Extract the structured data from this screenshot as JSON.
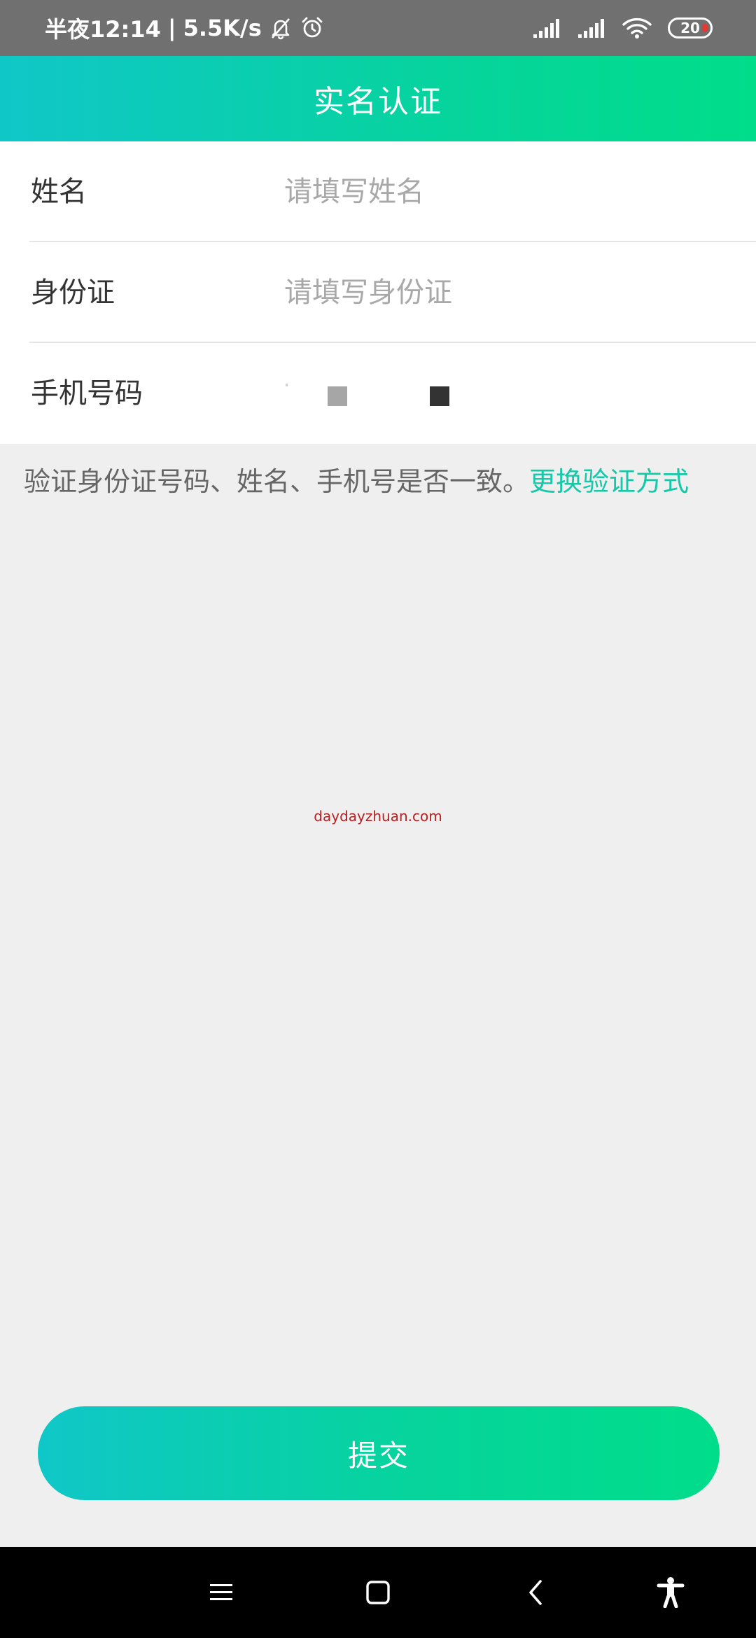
{
  "status_bar": {
    "time": "半夜12:14",
    "separator": "|",
    "speed": "5.5K/s",
    "battery": "20",
    "icons": [
      "mute-bell-icon",
      "alarm-icon",
      "signal-icon",
      "signal-icon",
      "wifi-icon",
      "battery-icon"
    ]
  },
  "header": {
    "title": "实名认证"
  },
  "form": {
    "rows": [
      {
        "label": "姓名",
        "placeholder": "请填写姓名",
        "value": ""
      },
      {
        "label": "身份证",
        "placeholder": "请填写身份证",
        "value": ""
      },
      {
        "label": "手机号码",
        "placeholder": "",
        "value": ""
      }
    ]
  },
  "note": {
    "text": "验证身份证号码、姓名、手机号是否一致。",
    "link": "更换验证方式"
  },
  "watermark": "daydayzhuan.com",
  "submit": {
    "label": "提交"
  },
  "nav_bar": {
    "icons": [
      "menu-icon",
      "home-icon",
      "back-icon",
      "accessibility-icon"
    ]
  },
  "colors": {
    "accent_start": "#10c7c8",
    "accent_end": "#00dd8a",
    "link": "#14c8a8"
  }
}
